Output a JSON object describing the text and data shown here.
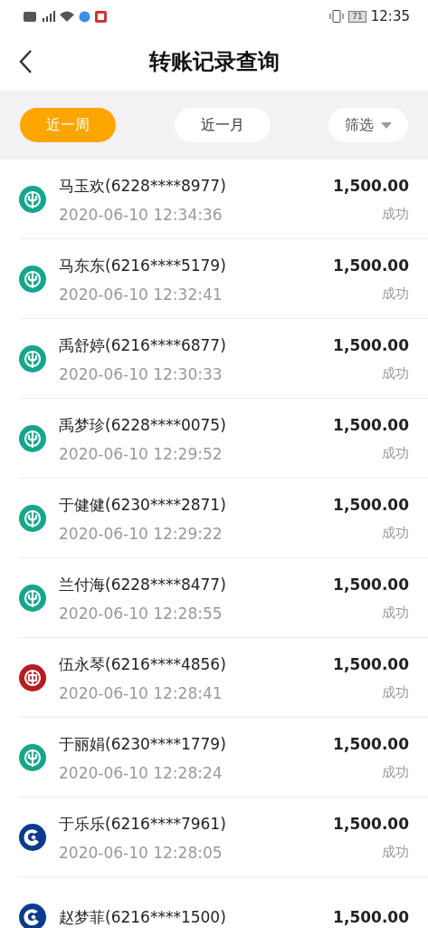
{
  "status_bar": {
    "battery": "71",
    "time": "12:35"
  },
  "header": {
    "title": "转账记录查询"
  },
  "tabs": [
    {
      "label": "近一周",
      "selected": true
    },
    {
      "label": "近一月",
      "selected": false
    }
  ],
  "filter": {
    "label": "筛选"
  },
  "transfers": [
    {
      "kind": "wheat",
      "color": "#16a68b",
      "name": "马玉欢(6228****8977)",
      "time": "2020-06-10 12:34:36",
      "amount": "1,500.00",
      "status": "成功"
    },
    {
      "kind": "wheat",
      "color": "#16a68b",
      "name": "马东东(6216****5179)",
      "time": "2020-06-10 12:32:41",
      "amount": "1,500.00",
      "status": "成功"
    },
    {
      "kind": "wheat",
      "color": "#16a68b",
      "name": "禹舒婷(6216****6877)",
      "time": "2020-06-10 12:30:33",
      "amount": "1,500.00",
      "status": "成功"
    },
    {
      "kind": "wheat",
      "color": "#16a68b",
      "name": "禹梦珍(6228****0075)",
      "time": "2020-06-10 12:29:52",
      "amount": "1,500.00",
      "status": "成功"
    },
    {
      "kind": "wheat",
      "color": "#16a68b",
      "name": "于健健(6230****2871)",
      "time": "2020-06-10 12:29:22",
      "amount": "1,500.00",
      "status": "成功"
    },
    {
      "kind": "wheat",
      "color": "#16a68b",
      "name": "兰付海(6228****8477)",
      "time": "2020-06-10 12:28:55",
      "amount": "1,500.00",
      "status": "成功"
    },
    {
      "kind": "coin",
      "color": "#b51c24",
      "name": "伍永琴(6216****4856)",
      "time": "2020-06-10 12:28:41",
      "amount": "1,500.00",
      "status": "成功"
    },
    {
      "kind": "wheat",
      "color": "#16a68b",
      "name": "于丽娟(6230****1779)",
      "time": "2020-06-10 12:28:24",
      "amount": "1,500.00",
      "status": "成功"
    },
    {
      "kind": "arc",
      "color": "#0c3b8d",
      "name": "于乐乐(6216****7961)",
      "time": "2020-06-10 12:28:05",
      "amount": "1,500.00",
      "status": "成功"
    },
    {
      "kind": "arc",
      "color": "#0c3b8d",
      "name": "赵梦菲(6216****1500)",
      "amount": "1,500.00"
    }
  ]
}
